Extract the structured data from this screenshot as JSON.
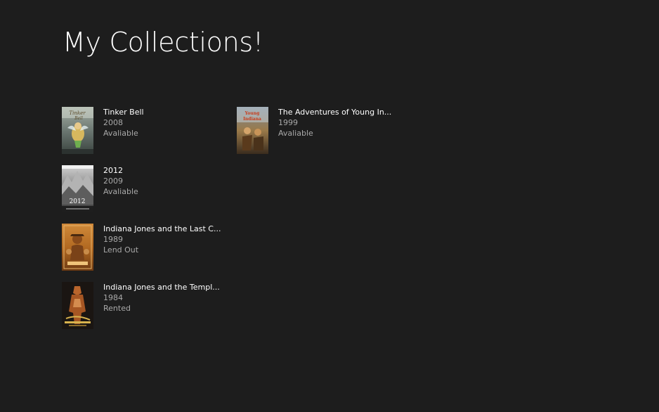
{
  "page": {
    "title": "My Collections!"
  },
  "colors": {
    "background": "#1d1d1d",
    "title_text": "#ffffff",
    "secondary_text": "#a9a9a9"
  },
  "collection": {
    "items": [
      {
        "title": "Tinker Bell",
        "year": "2008",
        "status": "Avaliable",
        "poster_icon": "tinker-bell-poster"
      },
      {
        "title": "2012",
        "year": "2009",
        "status": "Avaliable",
        "poster_icon": "2012-poster"
      },
      {
        "title": "Indiana Jones and the Last C...",
        "year": "1989",
        "status": "Lend Out",
        "poster_icon": "indiana-jones-last-crusade-poster"
      },
      {
        "title": "Indiana Jones and the Templ...",
        "year": "1984",
        "status": "Rented",
        "poster_icon": "indiana-jones-temple-of-doom-poster"
      },
      {
        "title": "The Adventures of Young In...",
        "year": "1999",
        "status": "Avaliable",
        "poster_icon": "young-indiana-jones-poster"
      }
    ]
  }
}
